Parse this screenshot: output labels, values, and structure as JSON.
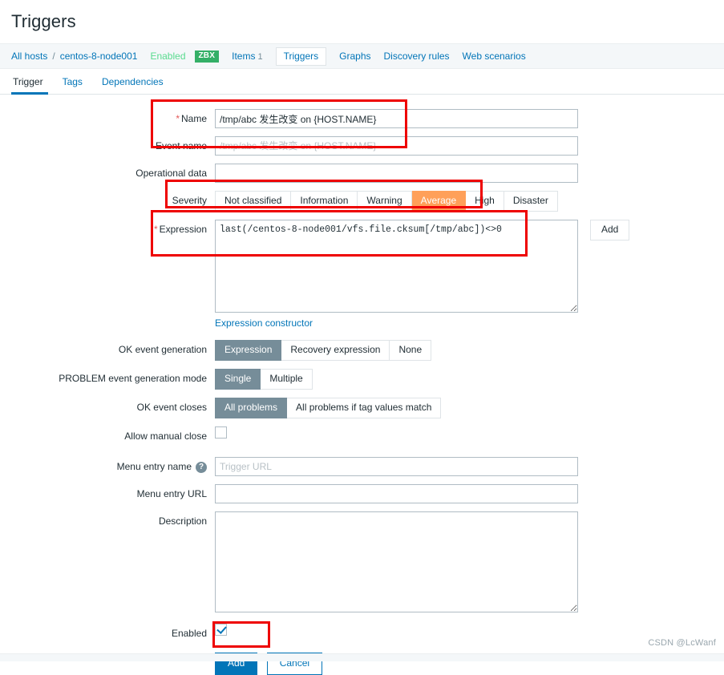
{
  "page": {
    "title": "Triggers"
  },
  "breadcrumb": {
    "all_hosts": "All hosts",
    "separator": "/",
    "host": "centos-8-node001",
    "status": "Enabled",
    "agent_badge": "ZBX",
    "items_label": "Items",
    "items_count": "1",
    "current": "Triggers",
    "graphs": "Graphs",
    "discovery_rules": "Discovery rules",
    "web_scenarios": "Web scenarios"
  },
  "tabs": [
    {
      "label": "Trigger",
      "active": true
    },
    {
      "label": "Tags",
      "active": false
    },
    {
      "label": "Dependencies",
      "active": false
    }
  ],
  "form": {
    "name": {
      "label": "Name",
      "required": "*",
      "value": "/tmp/abc 发生改变 on {HOST.NAME}"
    },
    "event_name": {
      "label": "Event name",
      "value": "",
      "placeholder": "/tmp/abc 发生改变 on {HOST.NAME}"
    },
    "operational_data": {
      "label": "Operational data",
      "value": "",
      "placeholder": ""
    },
    "severity": {
      "label": "Severity",
      "options": [
        "Not classified",
        "Information",
        "Warning",
        "Average",
        "High",
        "Disaster"
      ],
      "selected": "Average",
      "selected_color": "#ffa059"
    },
    "expression": {
      "label": "Expression",
      "required": "*",
      "value": "last(/centos-8-node001/vfs.file.cksum[/tmp/abc])<>0",
      "add_button": "Add",
      "constructor_link": "Expression constructor"
    },
    "ok_event_generation": {
      "label": "OK event generation",
      "options": [
        "Expression",
        "Recovery expression",
        "None"
      ],
      "selected": "Expression"
    },
    "problem_event_generation_mode": {
      "label": "PROBLEM event generation mode",
      "options": [
        "Single",
        "Multiple"
      ],
      "selected": "Single"
    },
    "ok_event_closes": {
      "label": "OK event closes",
      "options": [
        "All problems",
        "All problems if tag values match"
      ],
      "selected": "All problems"
    },
    "allow_manual_close": {
      "label": "Allow manual close",
      "checked": false
    },
    "menu_entry_name": {
      "label": "Menu entry name",
      "help_icon": "?",
      "value": "",
      "placeholder": "Trigger URL"
    },
    "menu_entry_url": {
      "label": "Menu entry URL",
      "value": "",
      "placeholder": ""
    },
    "description": {
      "label": "Description",
      "value": "",
      "placeholder": ""
    },
    "enabled": {
      "label": "Enabled",
      "checked": true
    }
  },
  "actions": {
    "submit": "Add",
    "cancel": "Cancel"
  },
  "watermark": "CSDN @LcWanf",
  "colors": {
    "accent": "#0275b8",
    "severity_average": "#ffa059",
    "segment_selected": "#768d99",
    "annotation": "#ee0000",
    "agent_badge": "#34af67",
    "status_enabled": "#59db8f"
  }
}
